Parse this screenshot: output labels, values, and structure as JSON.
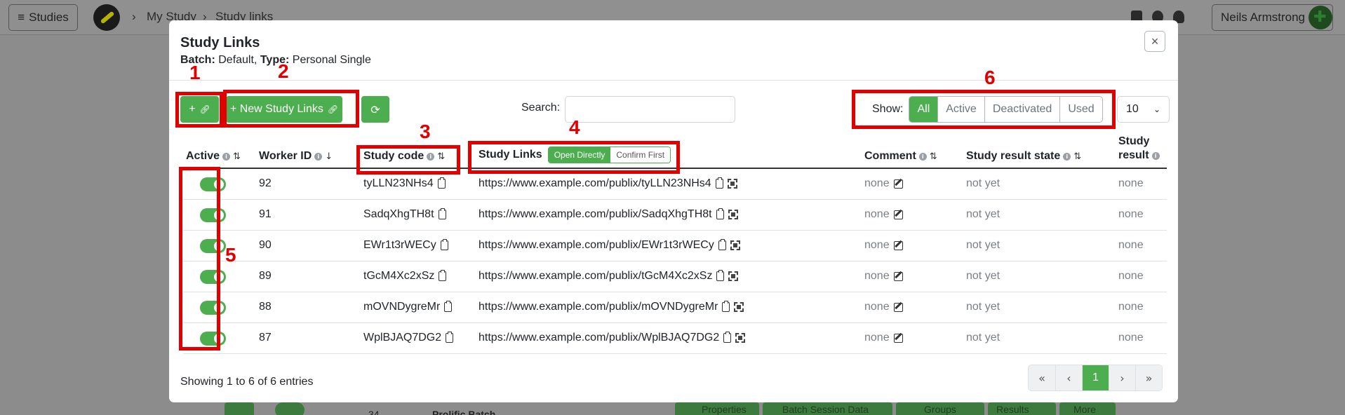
{
  "background": {
    "studies_button": "Studies",
    "breadcrumb": [
      "My Study",
      "Study links"
    ],
    "user_name": "Neils Armstrong",
    "footer_fragments": [
      "34",
      "Prolific Batch",
      "Properties",
      "Batch Session Data",
      "Groups",
      "Results",
      "More"
    ]
  },
  "modal": {
    "title": "Study Links",
    "subtitle": {
      "batch_label": "Batch:",
      "batch_value": "Default,",
      "type_label": "Type:",
      "type_value": "Personal Single"
    },
    "close_symbol": "×",
    "toolbar": {
      "add_link_label": "+",
      "new_links_label": "+ New Study Links",
      "search_label": "Search:",
      "search_value": "",
      "show_label": "Show:",
      "show_options": [
        "All",
        "Active",
        "Deactivated",
        "Used"
      ],
      "show_selected": "All",
      "page_size": "10"
    },
    "columns": {
      "active": "Active",
      "worker_id": "Worker ID",
      "study_code": "Study code",
      "study_links": "Study Links",
      "link_mode_open": "Open Directly",
      "link_mode_confirm": "Confirm First",
      "comment": "Comment",
      "result_state": "Study result state",
      "study_result_line1": "Study",
      "study_result_line2": "result"
    },
    "rows": [
      {
        "worker_id": "92",
        "code": "tyLLN23NHs4",
        "link": "https://www.example.com/publix/tyLLN23NHs4",
        "comment": "none",
        "state": "not yet",
        "result": "none"
      },
      {
        "worker_id": "91",
        "code": "SadqXhgTH8t",
        "link": "https://www.example.com/publix/SadqXhgTH8t",
        "comment": "none",
        "state": "not yet",
        "result": "none"
      },
      {
        "worker_id": "90",
        "code": "EWr1t3rWECy",
        "link": "https://www.example.com/publix/EWr1t3rWECy",
        "comment": "none",
        "state": "not yet",
        "result": "none"
      },
      {
        "worker_id": "89",
        "code": "tGcM4Xc2xSz",
        "link": "https://www.example.com/publix/tGcM4Xc2xSz",
        "comment": "none",
        "state": "not yet",
        "result": "none"
      },
      {
        "worker_id": "88",
        "code": "mOVNDygreMr",
        "link": "https://www.example.com/publix/mOVNDygreMr",
        "comment": "none",
        "state": "not yet",
        "result": "none"
      },
      {
        "worker_id": "87",
        "code": "WplBJAQ7DG2",
        "link": "https://www.example.com/publix/WplBJAQ7DG2",
        "comment": "none",
        "state": "not yet",
        "result": "none"
      }
    ],
    "footer_text": "Showing 1 to 6 of 6 entries",
    "pager": {
      "first": "«",
      "prev": "‹",
      "current": "1",
      "next": "›",
      "last": "»"
    }
  },
  "annotations": [
    "1",
    "2",
    "3",
    "4",
    "5",
    "6"
  ],
  "colors": {
    "accent": "#4cae4f",
    "annotation": "#e00000",
    "backdrop": "#8c8c8c"
  }
}
